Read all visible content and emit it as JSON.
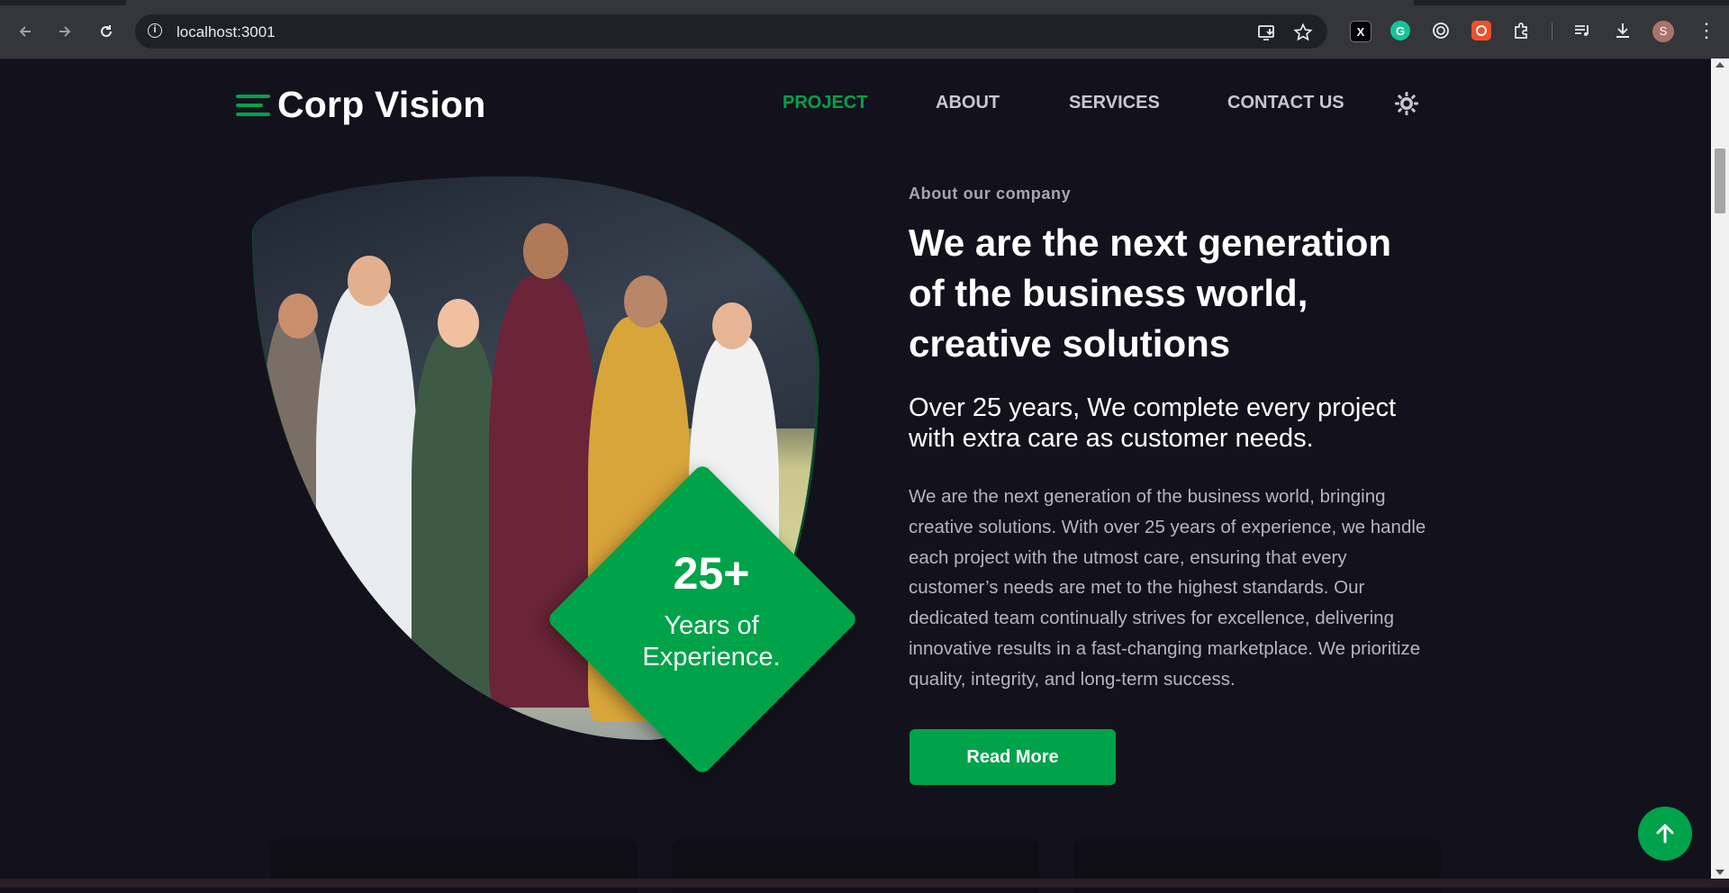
{
  "browser": {
    "url": "localhost:3001",
    "avatar_initial": "S",
    "icons": [
      "back-arrow-icon",
      "forward-arrow-icon",
      "reload-icon",
      "site-info-icon",
      "install-app-icon",
      "bookmark-star-icon",
      "extension-x-icon",
      "grammarly-icon",
      "extension-target-icon",
      "extension-record-icon",
      "extensions-puzzle-icon",
      "media-control-icon",
      "downloads-icon",
      "menu-kebab-icon"
    ]
  },
  "header": {
    "brand": "Corp Vision",
    "nav": [
      {
        "label": "PROJECT",
        "active": true
      },
      {
        "label": "ABOUT",
        "active": false
      },
      {
        "label": "SERVICES",
        "active": false
      },
      {
        "label": "CONTACT US",
        "active": false
      }
    ]
  },
  "badge": {
    "number": "25+",
    "line1": "Years of",
    "line2": "Experience."
  },
  "about": {
    "eyebrow": "About our company",
    "headline_1": "We are the next generation",
    "headline_2": "of the business world,",
    "headline_3": "creative solutions",
    "subhead_1": "Over 25 years, We complete every project",
    "subhead_2": "with extra care as customer needs.",
    "body": "We are the next generation of the business world, bringing creative solutions. With over 25 years of experience, we handle each project with the utmost care, ensuring that every customer’s needs are met to the highest standards. Our dedicated team continually strives for excellence, delivering innovative results in a fast-changing marketplace. We prioritize quality, integrity, and long-term success.",
    "cta": "Read More"
  },
  "colors": {
    "accent": "#00a34a",
    "background": "#13121c",
    "blob_shadow": "#0c4a2a"
  }
}
